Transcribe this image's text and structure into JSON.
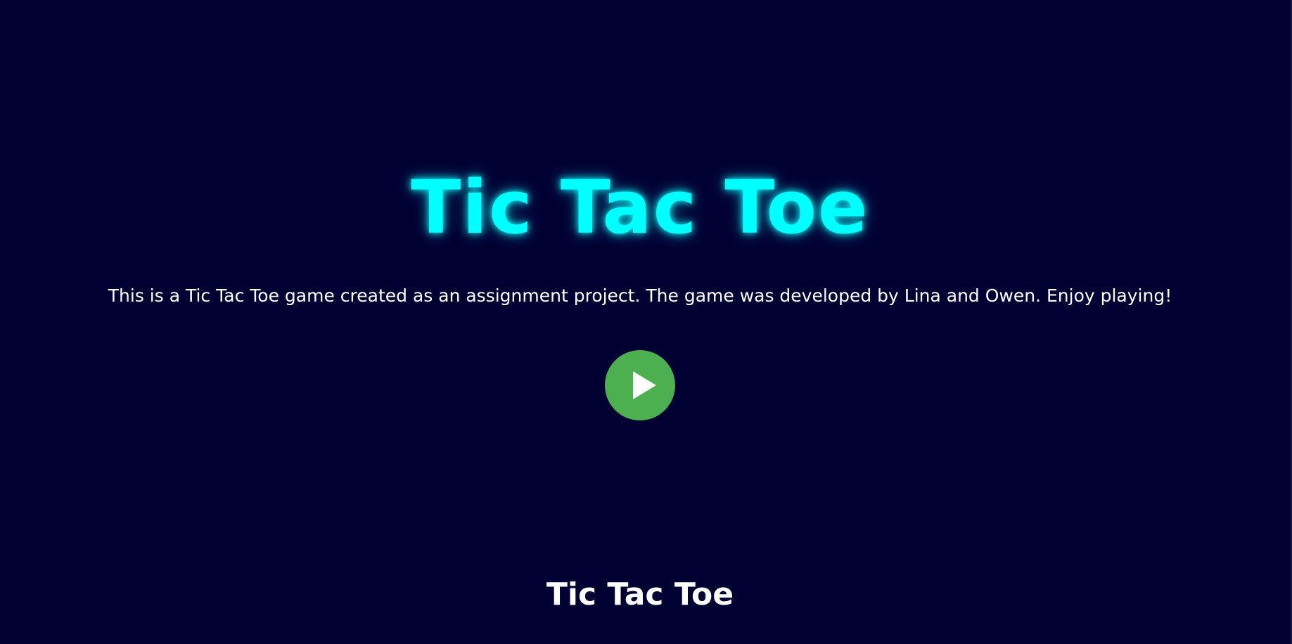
{
  "page": {
    "title": "Tic Tac Toe",
    "description": "This is a Tic Tac Toe game created as an assignment project. The game was developed by Lina and Owen. Enjoy playing!",
    "play_button": {
      "icon": "play-icon",
      "color": "#4caf50"
    },
    "footer_title": "Tic Tac Toe"
  },
  "colors": {
    "background": "#000033",
    "title": "#00ffff",
    "text": "#ffffff"
  }
}
